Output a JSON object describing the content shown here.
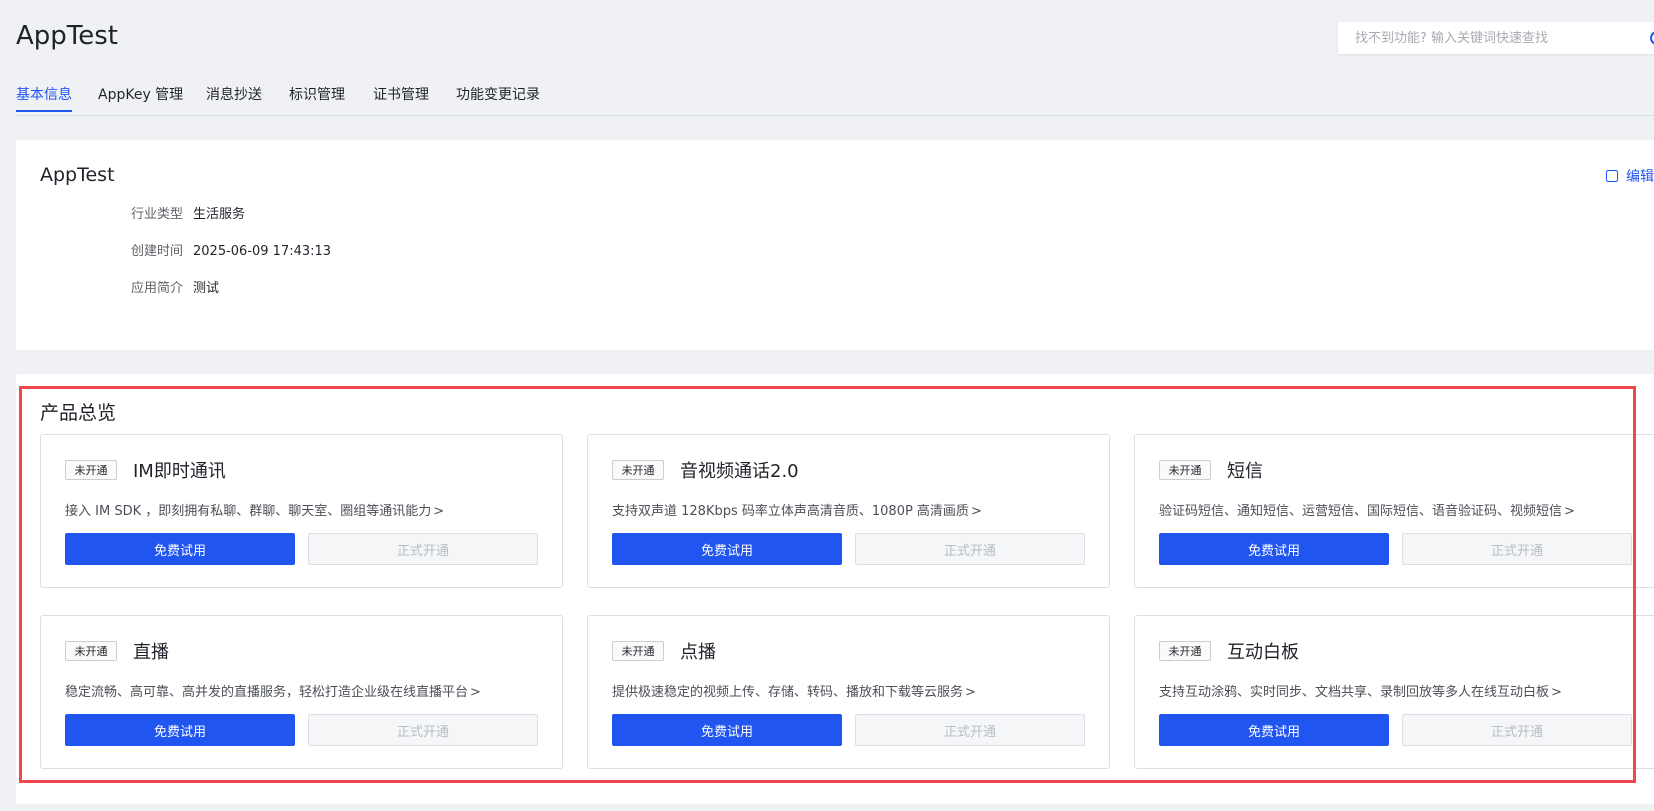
{
  "header": {
    "title": "AppTest",
    "search_placeholder": "找不到功能? 输入关键词快速查找"
  },
  "tabs": [
    {
      "label": "基本信息",
      "active": true
    },
    {
      "label": "AppKey 管理",
      "active": false
    },
    {
      "label": "消息抄送",
      "active": false
    },
    {
      "label": "标识管理",
      "active": false
    },
    {
      "label": "证书管理",
      "active": false
    },
    {
      "label": "功能变更记录",
      "active": false
    }
  ],
  "info_card": {
    "title": "AppTest",
    "edit_label": "编辑",
    "rows": [
      {
        "label": "行业类型",
        "value": "生活服务"
      },
      {
        "label": "创建时间",
        "value": "2025-06-09 17:43:13"
      },
      {
        "label": "应用简介",
        "value": "测试"
      }
    ]
  },
  "products_section": {
    "title": "产品总览",
    "trial_label": "免费试用",
    "open_label": "正式开通",
    "chevron": ">",
    "items": [
      {
        "badge": "未开通",
        "name": "IM即时通讯",
        "desc": "接入 IM SDK ，即刻拥有私聊、群聊、聊天室、圈组等通讯能力"
      },
      {
        "badge": "未开通",
        "name": "音视频通话2.0",
        "desc": "支持双声道 128Kbps 码率立体声高清音质、1080P 高清画质"
      },
      {
        "badge": "未开通",
        "name": "短信",
        "desc": "验证码短信、通知短信、运营短信、国际短信、语音验证码、视频短信"
      },
      {
        "badge": "未开通",
        "name": "直播",
        "desc": "稳定流畅、高可靠、高并发的直播服务，轻松打造企业级在线直播平台"
      },
      {
        "badge": "未开通",
        "name": "点播",
        "desc": "提供极速稳定的视频上传、存储、转码、播放和下载等云服务"
      },
      {
        "badge": "未开通",
        "name": "互动白板",
        "desc": "支持互动涂鸦、实时同步、文档共享、录制回放等多人在线互动白板"
      }
    ]
  },
  "colors": {
    "accent": "#2155f0",
    "highlight_border": "#f2474c",
    "page_bg": "#f0f1f5"
  }
}
